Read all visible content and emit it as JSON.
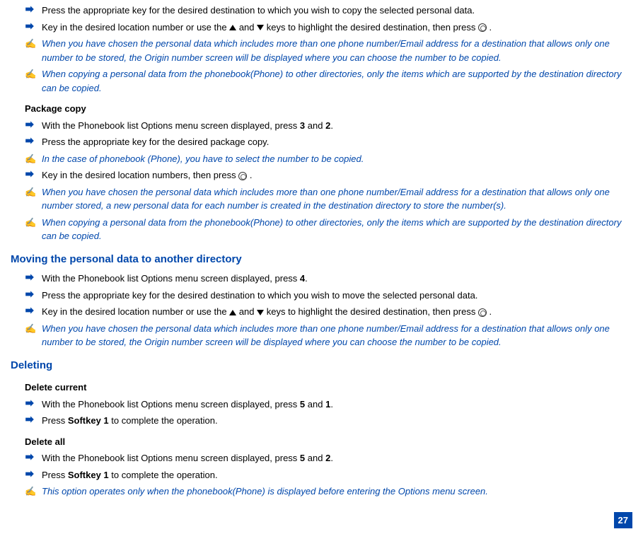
{
  "lines": {
    "l1": "Press the appropriate key for the desired destination to which you wish to copy the selected personal data.",
    "l2a": "Key in the desired location number or use the ",
    "l2b": " and ",
    "l2c": " keys to highlight the desired destination, then press ",
    "l2d": " .",
    "l3": "When you have chosen the personal data which includes more than one phone number/Email address for a destination that allows only one number to be stored, the Origin number screen will be displayed where you can choose the number to be copied.",
    "l4": "When copying a personal data from the phonebook(Phone) to other directories, only the items which are supported by the destination directory can be copied.",
    "pkg_heading": "Package copy",
    "l5a": "With the Phonebook list Options menu screen displayed, press ",
    "l5b": "3",
    "l5c": " and ",
    "l5d": "2",
    "l5e": ".",
    "l6": "Press the appropriate key for the desired package copy.",
    "l7": "In the case of phonebook (Phone), you have to select the number to be copied.",
    "l8a": "Key in the desired location numbers, then press ",
    "l8b": " .",
    "l9": "When you have chosen the personal data which includes more than one phone number/Email address for a destination that allows only one number stored, a new personal data for each number is created in the destination directory to store the number(s).",
    "l10": "When copying a personal data from the phonebook(Phone) to other directories, only the items which are supported by the destination directory can be copied.",
    "moving_heading": "Moving the personal data to another directory",
    "l11a": "With the Phonebook list Options menu screen displayed, press ",
    "l11b": "4",
    "l11c": ".",
    "l12": "Press the appropriate key for the desired destination to which you wish to move the selected personal data.",
    "l13a": "Key in the desired location number or use the ",
    "l13b": " and ",
    "l13c": " keys to highlight the desired destination, then press ",
    "l13d": " .",
    "l14": "When you have chosen the personal data which includes more than one phone number/Email address for a destination that allows only one number to be stored, the Origin number screen will be displayed where you can choose the number to be copied.",
    "deleting_heading": "Deleting",
    "dc_heading": "Delete current",
    "l15a": "With the Phonebook list Options menu screen displayed, press ",
    "l15b": "5",
    "l15c": " and ",
    "l15d": "1",
    "l15e": ".",
    "l16a": "Press ",
    "l16b": "Softkey 1",
    "l16c": " to complete the operation.",
    "da_heading": "Delete all",
    "l17a": "With the Phonebook list Options menu screen displayed, press ",
    "l17b": "5",
    "l17c": " and ",
    "l17d": "2",
    "l17e": ".",
    "l18a": "Press ",
    "l18b": "Softkey 1",
    "l18c": " to complete the operation.",
    "l19": "This option operates only when the phonebook(Phone) is displayed before entering the Options menu screen."
  },
  "page_number": "27",
  "note_glyph": "✍"
}
